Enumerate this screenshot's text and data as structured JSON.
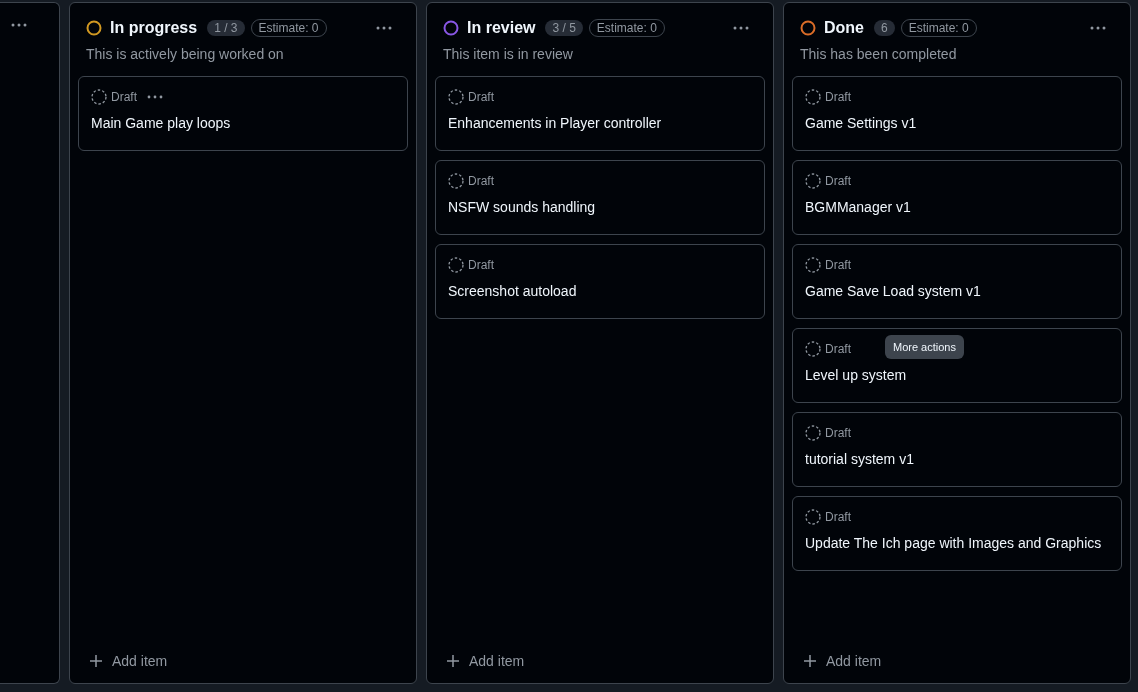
{
  "columns": [
    {
      "title": "In progress",
      "color": "#d29922",
      "count": "1 / 3",
      "estimate": "Estimate: 0",
      "description": "This is actively being worked on",
      "add_label": "Add item",
      "items": [
        {
          "status": "Draft",
          "title": "Main Game play loops",
          "menu_shown": true
        }
      ]
    },
    {
      "title": "In review",
      "color": "#8957e5",
      "count": "3 / 5",
      "estimate": "Estimate: 0",
      "description": "This item is in review",
      "add_label": "Add item",
      "items": [
        {
          "status": "Draft",
          "title": "Enhancements in Player controller",
          "menu_shown": false
        },
        {
          "status": "Draft",
          "title": "NSFW sounds handling",
          "menu_shown": false
        },
        {
          "status": "Draft",
          "title": "Screenshot autoload",
          "menu_shown": false
        }
      ]
    },
    {
      "title": "Done",
      "color": "#db6d28",
      "count": "6",
      "estimate": "Estimate: 0",
      "description": "This has been completed",
      "add_label": "Add item",
      "items": [
        {
          "status": "Draft",
          "title": "Game Settings v1",
          "menu_shown": false
        },
        {
          "status": "Draft",
          "title": "BGMManager v1",
          "menu_shown": false
        },
        {
          "status": "Draft",
          "title": "Game Save Load system v1",
          "menu_shown": false
        },
        {
          "status": "Draft",
          "title": "Level up system",
          "menu_shown": false,
          "tooltip": "More actions"
        },
        {
          "status": "Draft",
          "title": "tutorial system v1",
          "menu_shown": false
        },
        {
          "status": "Draft",
          "title": "Update The Ich page with Images and Graphics",
          "menu_shown": false
        }
      ]
    }
  ]
}
